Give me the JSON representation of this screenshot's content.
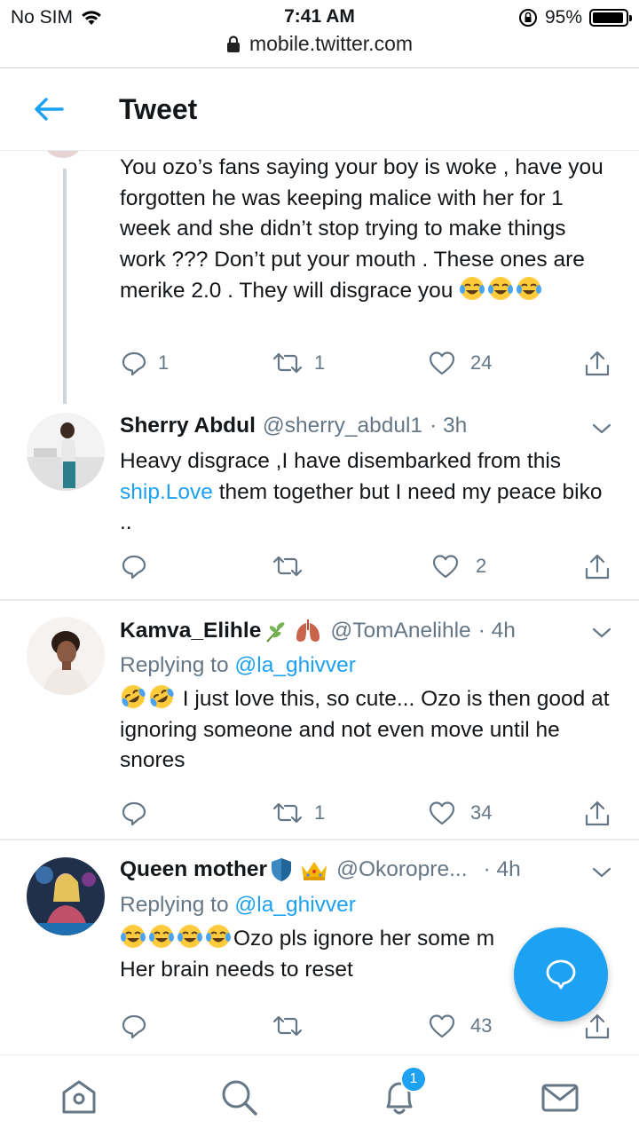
{
  "status_bar": {
    "carrier": "No SIM",
    "time": "7:41 AM",
    "battery_percent": "95%",
    "battery_level": 0.95
  },
  "browser": {
    "url": "mobile.twitter.com"
  },
  "header": {
    "title": "Tweet"
  },
  "tweets": [
    {
      "text": "You ozo’s fans saying your boy is woke , have you forgotten he was keeping malice with her for 1 week and she didn’t stop trying to make things work ??? Don’t put your mouth . These ones are merike 2.0 . They will disgrace you",
      "emoji": [
        "face-with-tears-of-joy",
        "face-with-tears-of-joy",
        "face-with-tears-of-joy"
      ],
      "replies": "1",
      "retweets": "1",
      "likes": "24"
    },
    {
      "name": "Sherry Abdul",
      "handle": "@sherry_abdul1",
      "time": "· 3h",
      "text_before_link": "Heavy disgrace ,I have disembarked from this ",
      "link": "ship.Love",
      "text_after_link": " them together but I need my peace biko ..",
      "replies": "",
      "retweets": "",
      "likes": "2"
    },
    {
      "name": "Kamva_Elihle",
      "handle": "@TomAnelihle",
      "time": "· 4h",
      "name_emoji": [
        "herb",
        "lungs"
      ],
      "replying_to_label": "Replying to",
      "replying_to": "@la_ghivver",
      "emoji": [
        "rolling-on-floor-laughing",
        "rolling-on-floor-laughing"
      ],
      "text": " I just love this, so cute... Ozo is then good at ignoring someone and not even move until he snores",
      "replies": "",
      "retweets": "1",
      "likes": "34"
    },
    {
      "name": "Queen mother",
      "handle": "@Okoropre...",
      "time": "· 4h",
      "name_emoji": [
        "shield",
        "crown"
      ],
      "replying_to_label": "Replying to",
      "replying_to": "@la_ghivver",
      "emoji": [
        "face-with-tears-of-joy",
        "face-with-tears-of-joy",
        "face-with-tears-of-joy",
        "face-with-tears-of-joy"
      ],
      "text_line1": "Ozo pls ignore her some m",
      "text_line2": "Her brain needs to reset",
      "replies": "",
      "retweets": "",
      "likes": "43"
    }
  ],
  "bottom_nav": {
    "items": [
      "home-icon",
      "search-icon",
      "notifications-icon",
      "messages-icon"
    ],
    "notification_badge": "1"
  },
  "colors": {
    "accent": "#1da1f2",
    "text": "#14171a",
    "secondary": "#657786",
    "border": "#e6ecf0"
  }
}
